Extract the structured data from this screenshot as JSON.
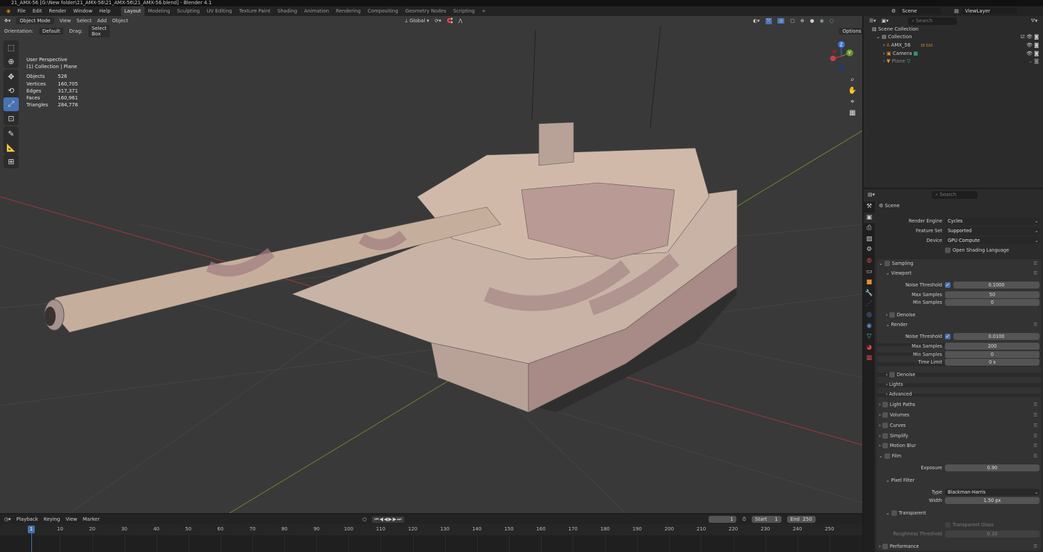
{
  "window_title": "21_AMX-56 [G:\\New folder\\21_AMX-56\\21_AMX-56\\21_AMX-56.blend] - Blender 4.1",
  "menu": [
    "File",
    "Edit",
    "Render",
    "Window",
    "Help"
  ],
  "workspaces": [
    "Layout",
    "Modeling",
    "Sculpting",
    "UV Editing",
    "Texture Paint",
    "Shading",
    "Animation",
    "Rendering",
    "Compositing",
    "Geometry Nodes",
    "Scripting",
    "+"
  ],
  "viewport_header": {
    "mode": "Object Mode",
    "menus": [
      "View",
      "Select",
      "Add",
      "Object"
    ],
    "transform": "Global",
    "options": "Options"
  },
  "tool_settings": {
    "orientation_label": "Orientation:",
    "orientation": "Default",
    "drag_label": "Drag:",
    "drag": "Select Box"
  },
  "overlay": {
    "view_name": "User Perspective",
    "collection": "(1) Collection | Plane",
    "stats": [
      [
        "Objects",
        "526"
      ],
      [
        "Vertices",
        "160,705"
      ],
      [
        "Edges",
        "317,371"
      ],
      [
        "Faces",
        "160,961"
      ],
      [
        "Triangles",
        "284,778"
      ]
    ]
  },
  "gizmo": {
    "x": "X",
    "y": "Y",
    "z": "Z"
  },
  "top_right": {
    "scene": "Scene",
    "view_layer": "ViewLayer"
  },
  "outliner": {
    "search_placeholder": "Search",
    "items": [
      {
        "name": "Scene Collection"
      },
      {
        "name": "Collection"
      },
      {
        "name": "AMX_56",
        "extra": "16 510"
      },
      {
        "name": "Camera"
      },
      {
        "name": "Plane"
      }
    ]
  },
  "properties": {
    "search_placeholder": "Search",
    "context": "Scene",
    "rows": [
      {
        "k": "field",
        "label": "Render Engine",
        "value": "Cycles",
        "menu": true
      },
      {
        "k": "field",
        "label": "Feature Set",
        "value": "Supported",
        "menu": true
      },
      {
        "k": "field",
        "label": "Device",
        "value": "GPU Compute",
        "menu": true
      },
      {
        "k": "check",
        "label": "Open Shading Language"
      },
      {
        "k": "sec",
        "label": "Sampling"
      },
      {
        "k": "sub",
        "label": "Viewport"
      },
      {
        "k": "field",
        "label": "Noise Threshold",
        "value": "0.1000",
        "checked": true
      },
      {
        "k": "field",
        "label": "Max Samples",
        "value": "50"
      },
      {
        "k": "field",
        "label": "Min Samples",
        "value": "0"
      },
      {
        "k": "subc",
        "label": "Denoise"
      },
      {
        "k": "sub",
        "label": "Render"
      },
      {
        "k": "field",
        "label": "Noise Threshold",
        "value": "0.0100",
        "checked": true
      },
      {
        "k": "field",
        "label": "Max Samples",
        "value": "200"
      },
      {
        "k": "field",
        "label": "Min Samples",
        "value": "0"
      },
      {
        "k": "field",
        "label": "Time Limit",
        "value": "0 s"
      },
      {
        "k": "subc",
        "label": "Denoise"
      },
      {
        "k": "sub",
        "label": "Lights"
      },
      {
        "k": "sub",
        "label": "Advanced"
      },
      {
        "k": "sec",
        "label": "Light Paths"
      },
      {
        "k": "sec",
        "label": "Volumes"
      },
      {
        "k": "sec",
        "label": "Curves"
      },
      {
        "k": "secc",
        "label": "Simplify"
      },
      {
        "k": "secc",
        "label": "Motion Blur"
      },
      {
        "k": "sec",
        "label": "Film"
      },
      {
        "k": "field",
        "label": "Exposure",
        "value": "0.90"
      },
      {
        "k": "sub",
        "label": "Pixel Filter"
      },
      {
        "k": "field",
        "label": "Type",
        "value": "Blackman-Harris",
        "menu": true
      },
      {
        "k": "field",
        "label": "Width",
        "value": "1.50 px"
      },
      {
        "k": "subc",
        "label": "Transparent"
      },
      {
        "k": "check",
        "label": "Transparent Glass",
        "disabled": true
      },
      {
        "k": "field",
        "label": "Roughness Threshold",
        "value": "0.10",
        "disabled": true
      },
      {
        "k": "sec",
        "label": "Performance"
      }
    ]
  },
  "timeline": {
    "menus": [
      "Playback",
      "Keying",
      "View",
      "Marker"
    ],
    "current_frame": "1",
    "start_label": "Start",
    "start": "1",
    "end_label": "End",
    "end": "250",
    "ticks": [
      "10",
      "20",
      "30",
      "40",
      "50",
      "60",
      "70",
      "80",
      "90",
      "100",
      "110",
      "120",
      "130",
      "140",
      "150",
      "160",
      "170",
      "180",
      "190",
      "200",
      "210",
      "220",
      "230",
      "240",
      "250"
    ]
  },
  "colors": {
    "accent": "#4772b3",
    "x_axis": "#a4343f",
    "y_axis": "#6a8a2a"
  }
}
